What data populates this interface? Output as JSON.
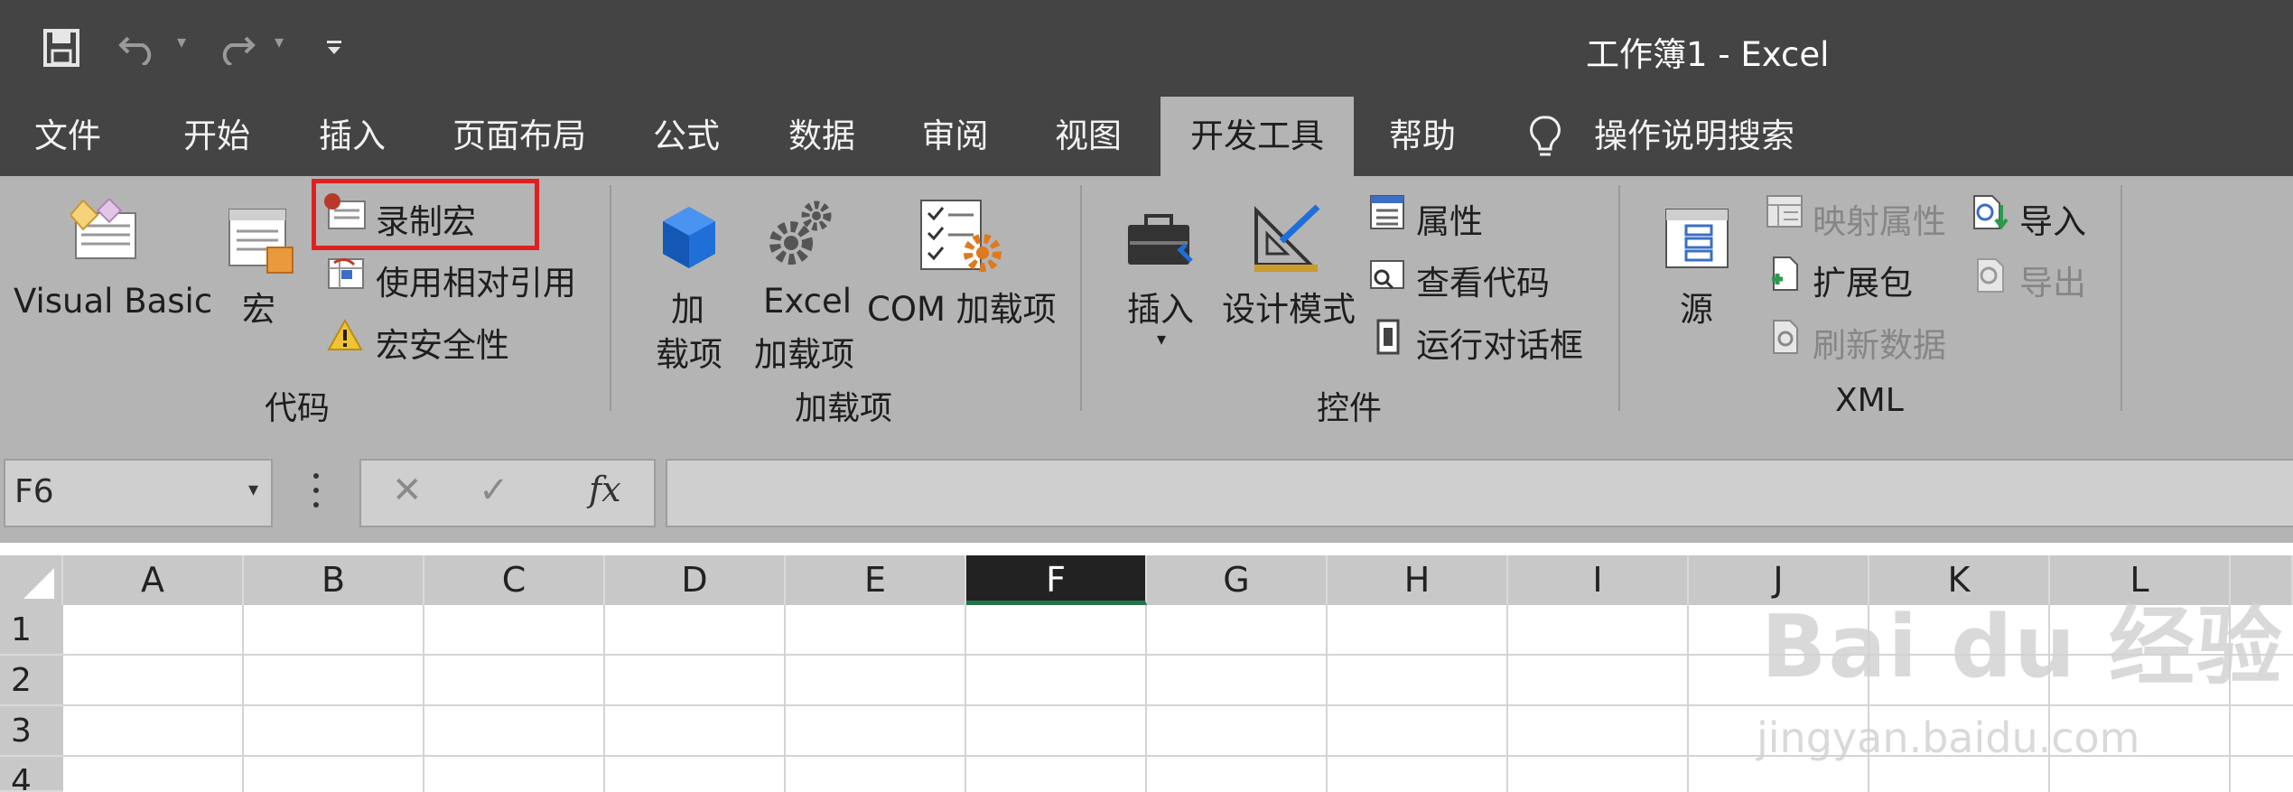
{
  "window": {
    "title": "工作簿1  -  Excel"
  },
  "tabs": [
    {
      "label": "文件"
    },
    {
      "label": "开始"
    },
    {
      "label": "插入"
    },
    {
      "label": "页面布局"
    },
    {
      "label": "公式"
    },
    {
      "label": "数据"
    },
    {
      "label": "审阅"
    },
    {
      "label": "视图"
    },
    {
      "label": "开发工具"
    },
    {
      "label": "帮助"
    },
    {
      "label": "操作说明搜索"
    }
  ],
  "ribbon": {
    "code": {
      "group_label": "代码",
      "visual_basic": "Visual Basic",
      "macros": "宏",
      "record_macro": "录制宏",
      "relative_refs": "使用相对引用",
      "macro_security": "宏安全性"
    },
    "addins": {
      "group_label": "加载项",
      "addins_line1": "加",
      "addins_line2": "载项",
      "excel_line1": "Excel",
      "excel_line2": "加载项",
      "com_addins": "COM 加载项"
    },
    "controls": {
      "group_label": "控件",
      "insert": "插入",
      "design_mode": "设计模式",
      "properties": "属性",
      "view_code": "查看代码",
      "run_dialog": "运行对话框"
    },
    "xml": {
      "group_label": "XML",
      "source": "源",
      "map_properties": "映射属性",
      "expansion_packs": "扩展包",
      "refresh_data": "刷新数据",
      "import": "导入",
      "export": "导出"
    }
  },
  "formula_bar": {
    "name_box": "F6",
    "fx_label": "fx",
    "formula": ""
  },
  "columns": [
    "A",
    "B",
    "C",
    "D",
    "E",
    "F",
    "G",
    "H",
    "I",
    "J",
    "K",
    "L"
  ],
  "rows": [
    "1",
    "2",
    "3",
    "4"
  ],
  "selected_column": "F",
  "highlight_color": "#e02020",
  "watermark": {
    "brand": "Bai du 经验",
    "url": "jingyan.baidu.com"
  }
}
